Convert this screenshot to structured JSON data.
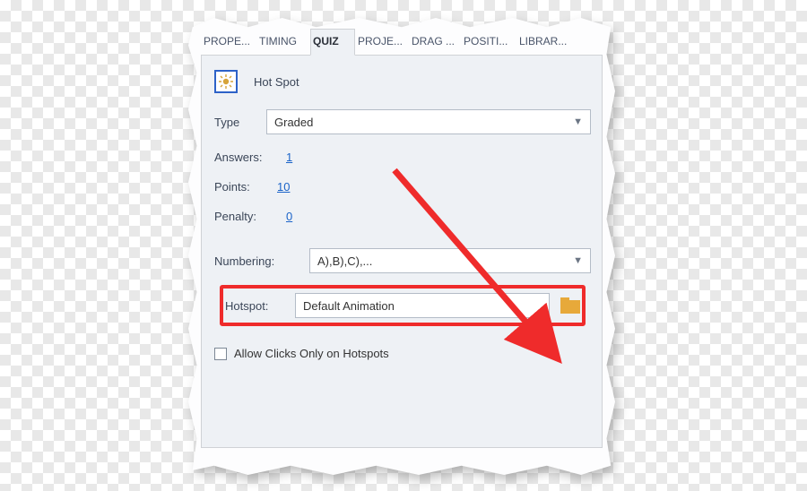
{
  "tabs": [
    {
      "label": "PROPE..."
    },
    {
      "label": "TIMING"
    },
    {
      "label": "QUIZ"
    },
    {
      "label": "PROJE..."
    },
    {
      "label": "DRAG ..."
    },
    {
      "label": "POSITI..."
    },
    {
      "label": "LIBRAR..."
    }
  ],
  "active_tab_index": 2,
  "header": {
    "title": "Hot Spot"
  },
  "type_row": {
    "label": "Type",
    "value": "Graded"
  },
  "answers": {
    "label": "Answers:",
    "value": "1"
  },
  "points": {
    "label": "Points:",
    "value": "10"
  },
  "penalty": {
    "label": "Penalty:",
    "value": "0"
  },
  "numbering": {
    "label": "Numbering:",
    "value": "A),B),C),..."
  },
  "hotspot": {
    "label": "Hotspot:",
    "value": "Default Animation"
  },
  "allow_clicks": {
    "label": "Allow Clicks Only on Hotspots",
    "checked": false
  }
}
